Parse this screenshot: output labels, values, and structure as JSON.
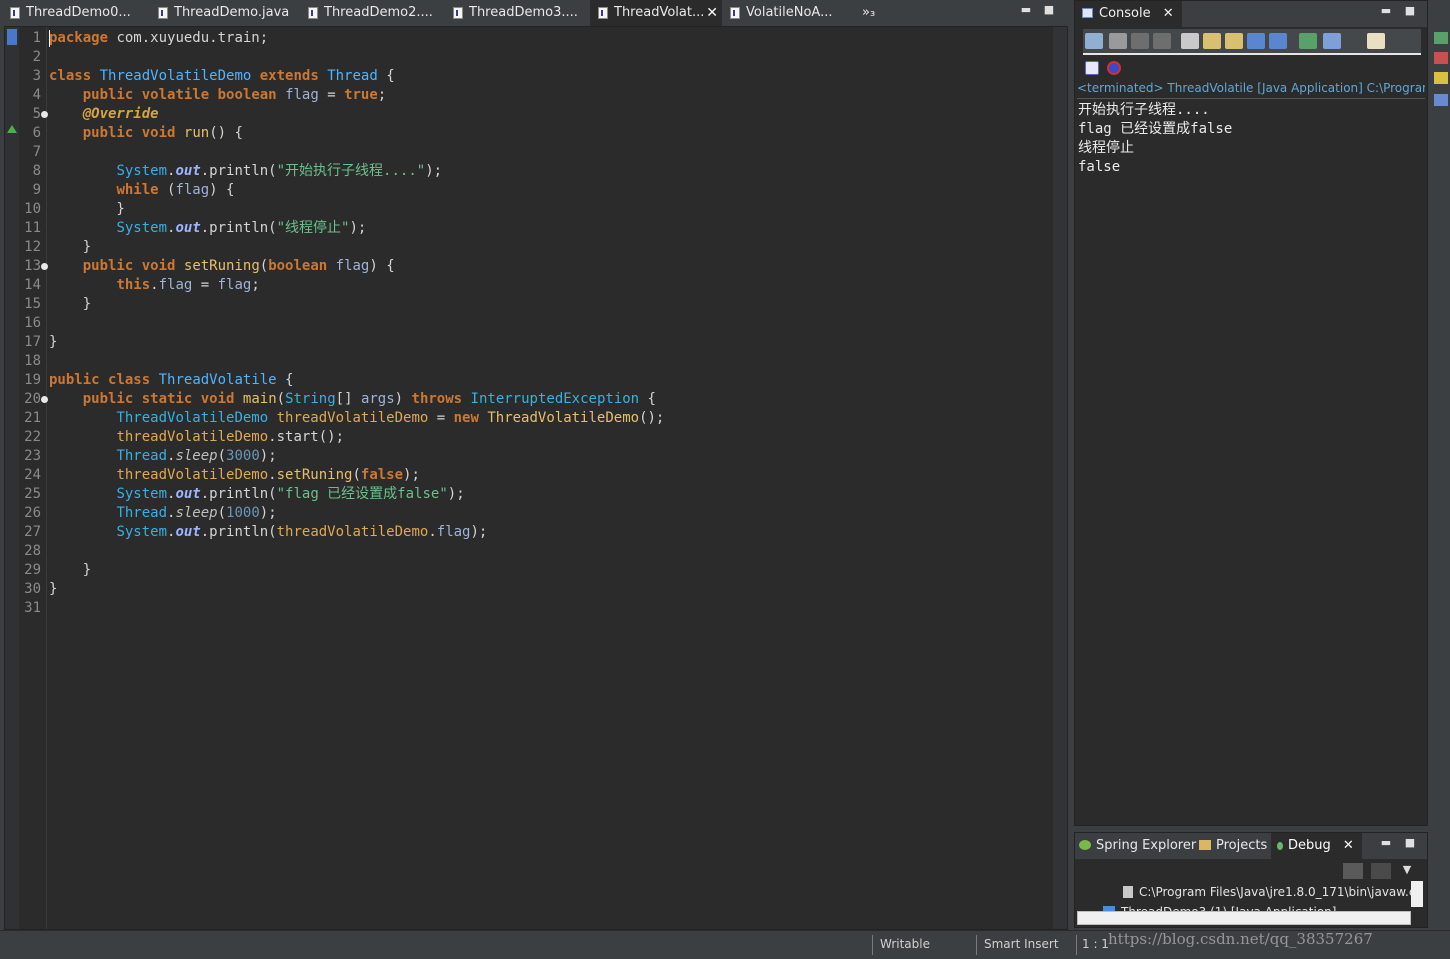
{
  "editor_tabs": [
    {
      "label": "ThreadDemo0..."
    },
    {
      "label": "ThreadDemo.java"
    },
    {
      "label": "ThreadDemo2...."
    },
    {
      "label": "ThreadDemo3...."
    },
    {
      "label": "ThreadVolat...",
      "active": true
    },
    {
      "label": "VolatileNoA..."
    }
  ],
  "overflow_label": "»₃",
  "editor": {
    "line_numbers": [
      "1",
      "2",
      "3",
      "4",
      "5",
      "6",
      "7",
      "8",
      "9",
      "10",
      "11",
      "12",
      "13",
      "14",
      "15",
      "16",
      "17",
      "18",
      "19",
      "20",
      "21",
      "22",
      "23",
      "24",
      "25",
      "26",
      "27",
      "28",
      "29",
      "30",
      "31"
    ],
    "lines": {
      "l1": [
        "package",
        " com.xuyuedu.train;"
      ],
      "l3": [
        "class",
        " ",
        "ThreadVolatileDemo",
        " ",
        "extends",
        " ",
        "Thread",
        " {"
      ],
      "l4": [
        "    ",
        "public",
        " ",
        "volatile",
        " ",
        "boolean",
        " ",
        "flag",
        " = ",
        "true",
        ";"
      ],
      "l5": [
        "    ",
        "@Override"
      ],
      "l6": [
        "    ",
        "public",
        " ",
        "void",
        " ",
        "run",
        "() {"
      ],
      "l8": [
        "        ",
        "System",
        ".",
        "out",
        ".println(",
        "\"开始执行子线程....\"",
        ");"
      ],
      "l9": [
        "        ",
        "while",
        " (",
        "flag",
        ") {"
      ],
      "l10": [
        "        }"
      ],
      "l11": [
        "        ",
        "System",
        ".",
        "out",
        ".println(",
        "\"线程停止\"",
        ");"
      ],
      "l12": [
        "    }"
      ],
      "l13": [
        "    ",
        "public",
        " ",
        "void",
        " ",
        "setRuning",
        "(",
        "boolean",
        " ",
        "flag",
        ") {"
      ],
      "l14": [
        "        ",
        "this",
        ".",
        "flag",
        " = ",
        "flag",
        ";"
      ],
      "l15": [
        "    }"
      ],
      "l17": [
        "}"
      ],
      "l19": [
        "public",
        " ",
        "class",
        " ",
        "ThreadVolatile",
        " {"
      ],
      "l20": [
        "    ",
        "public",
        " ",
        "static",
        " ",
        "void",
        " ",
        "main",
        "(",
        "String",
        "[] ",
        "args",
        ") ",
        "throws",
        " ",
        "InterruptedException",
        " {"
      ],
      "l21": [
        "        ",
        "ThreadVolatileDemo",
        " ",
        "threadVolatileDemo",
        " = ",
        "new",
        " ",
        "ThreadVolatileDemo",
        "();"
      ],
      "l22": [
        "        ",
        "threadVolatileDemo",
        ".start();"
      ],
      "l23": [
        "        ",
        "Thread",
        ".",
        "sleep",
        "(",
        "3000",
        ");"
      ],
      "l24": [
        "        ",
        "threadVolatileDemo",
        ".",
        "setRuning",
        "(",
        "false",
        ");"
      ],
      "l25": [
        "        ",
        "System",
        ".",
        "out",
        ".println(",
        "\"flag 已经设置成false\"",
        ");"
      ],
      "l26": [
        "        ",
        "Thread",
        ".",
        "sleep",
        "(",
        "1000",
        ");"
      ],
      "l27": [
        "        ",
        "System",
        ".",
        "out",
        ".println(",
        "threadVolatileDemo",
        ".",
        "flag",
        ");"
      ],
      "l29": [
        "    }"
      ],
      "l30": [
        "}"
      ]
    }
  },
  "console": {
    "tab_label": "Console",
    "close": "✕",
    "header": "<terminated> ThreadVolatile [Java Application] C:\\Program",
    "output": [
      "开始执行子线程....",
      "flag 已经设置成false",
      "线程停止",
      "false"
    ]
  },
  "debug_panel": {
    "tabs": [
      {
        "label": "Spring Explorer"
      },
      {
        "label": "Projects"
      },
      {
        "label": "Debug",
        "active": true
      }
    ],
    "close": "✕",
    "tree": [
      "C:\\Program Files\\Java\\jre1.8.0_171\\bin\\javaw.e",
      "ThreadDemo3 (1) [Java Application]"
    ]
  },
  "statusbar": {
    "writable": "Writable",
    "insert_mode": "Smart Insert",
    "position": "1 : 1"
  },
  "watermark": "https://blog.csdn.net/qq_38357267",
  "colors": {
    "editor_bg": "#2b2b2b",
    "keyword": "#cc7832",
    "type": "#36b1e6",
    "string": "#6ac08a",
    "number": "#6897bb",
    "method": "#e8bf6a"
  }
}
